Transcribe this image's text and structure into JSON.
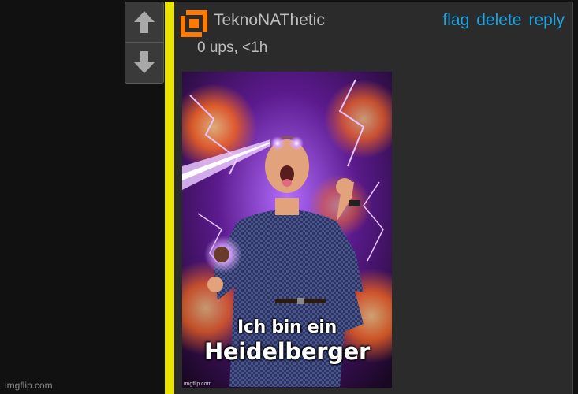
{
  "comment": {
    "username": "TeknoNAThetic",
    "meta": "0 ups, <1h",
    "actions": {
      "flag": "flag",
      "delete": "delete",
      "reply": "reply"
    }
  },
  "vote": {
    "up_icon": "arrow-up-icon",
    "down_icon": "arrow-down-icon"
  },
  "meme": {
    "caption_line1": "Ich bin ein",
    "caption_line2": "Heidelberger",
    "watermark": "imgflip.com"
  },
  "site_watermark": "imgflip.com",
  "colors": {
    "background": "#111111",
    "panel": "#2b2b2b",
    "highlight_bar": "#e8e400",
    "link": "#1fa3e0",
    "avatar": "#ff7a00"
  }
}
